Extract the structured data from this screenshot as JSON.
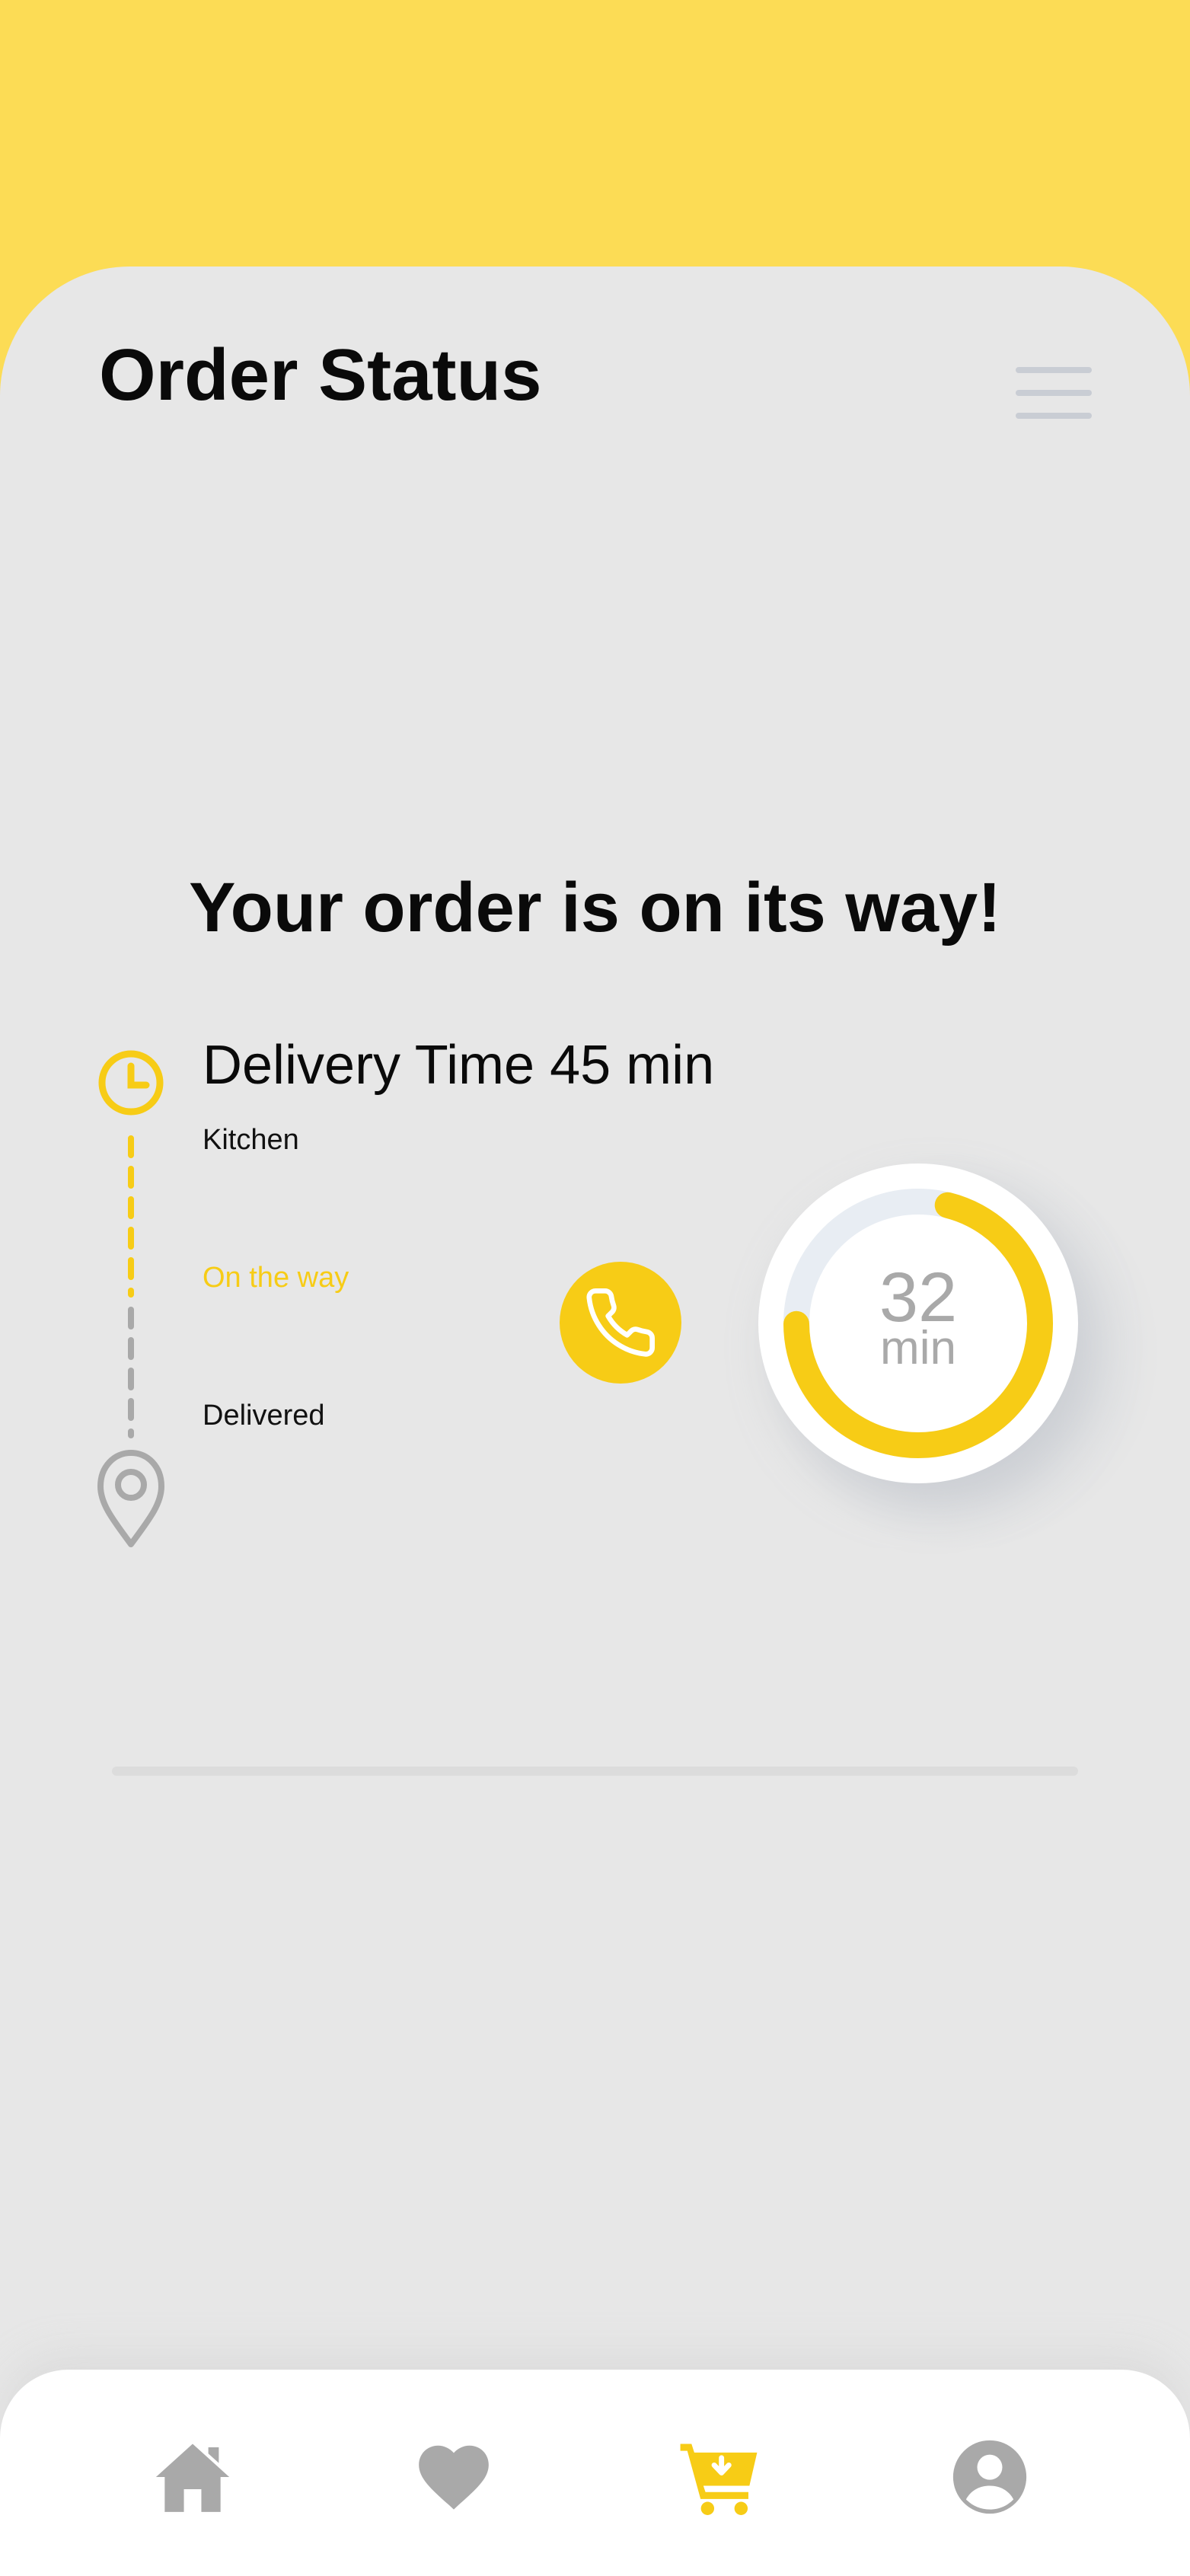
{
  "header": {
    "title": "Order Status",
    "menu_icon": "hamburger-menu-icon"
  },
  "status": {
    "headline": "Your order is on its way!",
    "delivery_time": "Delivery Time 45 min",
    "steps": [
      {
        "label": "Kitchen",
        "state": "done"
      },
      {
        "label": "On the way",
        "state": "active"
      },
      {
        "label": "Delivered",
        "state": "pending"
      }
    ]
  },
  "call": {
    "icon": "phone-icon"
  },
  "timer": {
    "value": "32",
    "unit": "min",
    "progress_fraction": 0.71
  },
  "bottom_nav": {
    "items": [
      {
        "icon": "home-icon",
        "active": false
      },
      {
        "icon": "heart-icon",
        "active": false
      },
      {
        "icon": "cart-icon",
        "active": true
      },
      {
        "icon": "profile-icon",
        "active": false
      }
    ]
  },
  "colors": {
    "accent": "#f7cc16",
    "header_yellow": "#fcdc55",
    "background": "#e7e7e7",
    "inactive_icon": "#a9a9a9"
  }
}
